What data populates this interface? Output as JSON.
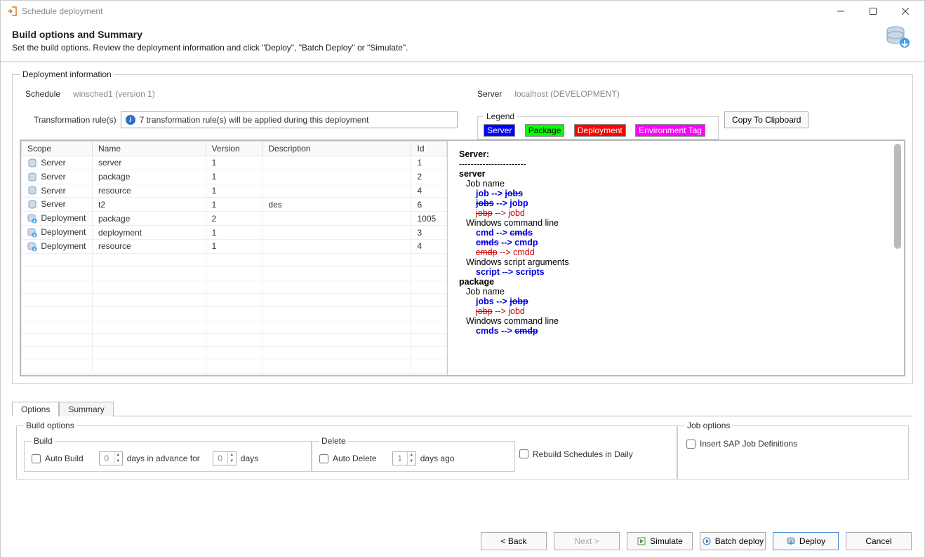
{
  "titlebar": {
    "title": "Schedule deployment"
  },
  "header": {
    "title": "Build options and Summary",
    "subtitle": "Set the build options. Review the deployment information and click \"Deploy\", \"Batch Deploy\" or \"Simulate\"."
  },
  "info": {
    "group_title": "Deployment information",
    "schedule_label": "Schedule",
    "schedule_value": "winsched1 (version 1)",
    "server_label": "Server",
    "server_value": "localhost (DEVELOPMENT)",
    "rules_label": "Transformation rule(s)",
    "rules_value": "7 transformation rule(s) will be applied during this deployment",
    "legend_title": "Legend",
    "legend_server": "Server",
    "legend_package": "Package",
    "legend_deployment": "Deployment",
    "legend_envtag": "Environment Tag",
    "copy_btn": "Copy To Clipboard"
  },
  "table": {
    "headers": {
      "scope": "Scope",
      "name": "Name",
      "version": "Version",
      "description": "Description",
      "id": "Id"
    },
    "rows": [
      {
        "scope": "Server",
        "name": "server",
        "version": "1",
        "description": "",
        "id": "1",
        "icon": "srv"
      },
      {
        "scope": "Server",
        "name": "package",
        "version": "1",
        "description": "",
        "id": "2",
        "icon": "srv"
      },
      {
        "scope": "Server",
        "name": "resource",
        "version": "1",
        "description": "",
        "id": "4",
        "icon": "srv"
      },
      {
        "scope": "Server",
        "name": "t2",
        "version": "1",
        "description": "des",
        "id": "6",
        "icon": "srv"
      },
      {
        "scope": "Deployment",
        "name": "package",
        "version": "2",
        "description": "",
        "id": "1005",
        "icon": "dep"
      },
      {
        "scope": "Deployment",
        "name": "deployment",
        "version": "1",
        "description": "",
        "id": "3",
        "icon": "dep"
      },
      {
        "scope": "Deployment",
        "name": "resource",
        "version": "1",
        "description": "",
        "id": "4",
        "icon": "dep"
      }
    ]
  },
  "detail": {
    "server_head": "Server:",
    "sub_server": "server",
    "jobname": "Job name",
    "wincmd": "Windows command line",
    "winargs": "Windows script arguments",
    "sub_package": "package",
    "r_job_jobs": "job --> jobs",
    "r_jobs_jobp": "jobs --> jobp",
    "r_jobp_jobd": "jobp --> jobd",
    "r_cmd_cmds": "cmd --> cmds",
    "r_cmds_cmdp": "cmds --> cmdp",
    "r_cmdp_cmdd": "cmdp --> cmdd",
    "r_script_scripts": "script --> scripts"
  },
  "tabs": {
    "options": "Options",
    "summary": "Summary"
  },
  "opts": {
    "build_group": "Build options",
    "build": "Build",
    "delete": "Delete",
    "job_group": "Job options",
    "auto_build": "Auto Build",
    "auto_build_val": "0",
    "days_advance": "days in advance for",
    "auto_build_days_val": "0",
    "days": "days",
    "auto_delete": "Auto Delete",
    "auto_delete_val": "1",
    "days_ago": "days ago",
    "rebuild": "Rebuild Schedules in Daily",
    "insert_sap": "Insert SAP Job Definitions"
  },
  "footer": {
    "back": "< Back",
    "next": "Next >",
    "simulate": "Simulate",
    "batch": "Batch deploy",
    "deploy": "Deploy",
    "cancel": "Cancel"
  }
}
